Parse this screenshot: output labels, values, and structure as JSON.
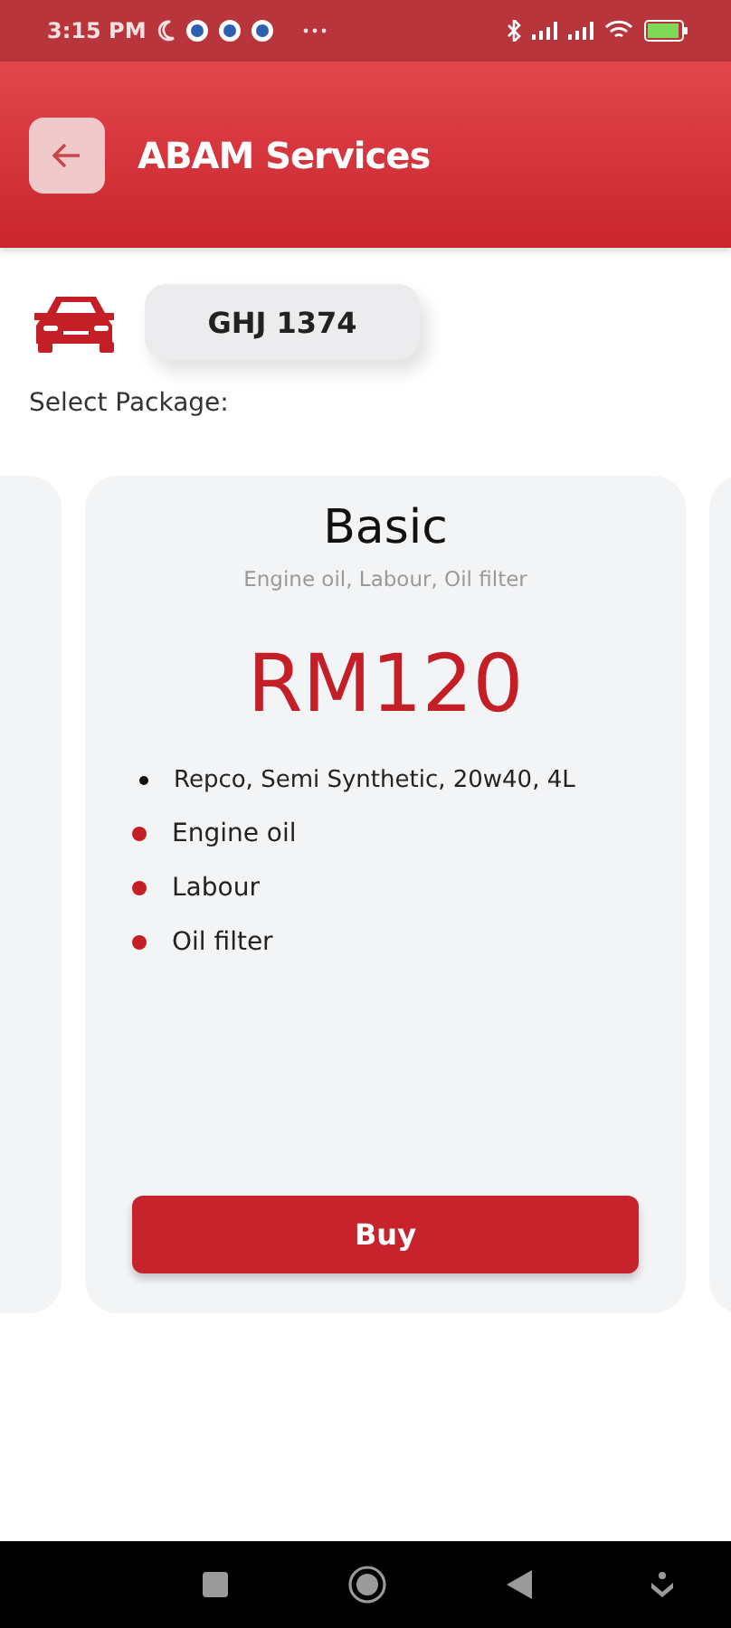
{
  "status_bar": {
    "time": "3:15 PM"
  },
  "header": {
    "title": "ABAM Services"
  },
  "vehicle": {
    "plate": "GHJ 1374"
  },
  "section_label": "Select Package:",
  "package": {
    "name": "Basic",
    "summary": "Engine oil, Labour, Oil filter",
    "price": "RM120",
    "items": [
      {
        "kind": "spec",
        "text": "Repco, Semi Synthetic, 20w40, 4L"
      },
      {
        "kind": "included",
        "text": "Engine oil"
      },
      {
        "kind": "included",
        "text": "Labour"
      },
      {
        "kind": "included",
        "text": "Oil filter"
      }
    ],
    "button": "Buy"
  }
}
